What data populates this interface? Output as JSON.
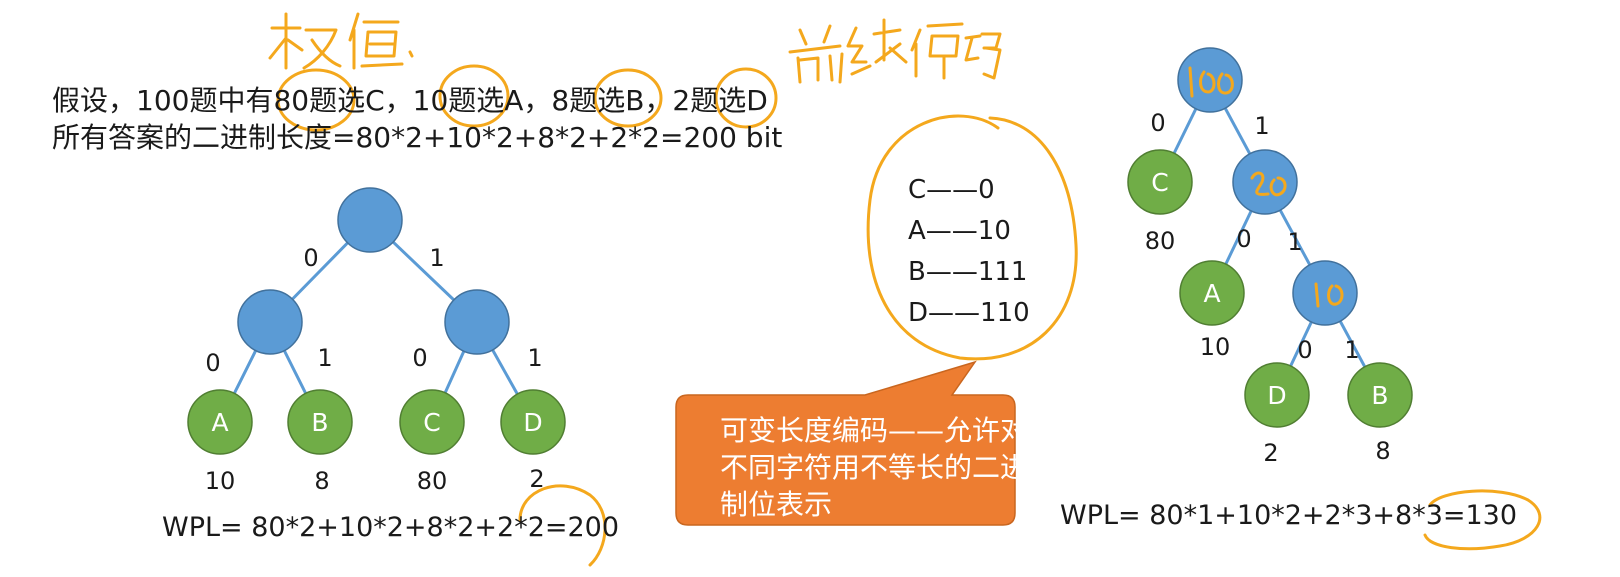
{
  "intro": {
    "line1": "假设，100题中有80题选C，10题选A，8题选B，2题选D",
    "line2": "所有答案的二进制长度=80*2+10*2+8*2+2*2=200 bit"
  },
  "handwriting": {
    "weight_note": "权值",
    "coding_note": "前缀编码"
  },
  "tree_fixed": {
    "edges": {
      "root_left": "0",
      "root_right": "1",
      "l_left": "0",
      "l_right": "1",
      "r_left": "0",
      "r_right": "1"
    },
    "leaves": [
      {
        "letter": "A",
        "weight": "10"
      },
      {
        "letter": "B",
        "weight": "8"
      },
      {
        "letter": "C",
        "weight": "80"
      },
      {
        "letter": "D",
        "weight": "2"
      }
    ],
    "wpl": "WPL= 80*2+10*2+8*2+2*2=200"
  },
  "codes": [
    "C——0",
    "A——10",
    "B——111",
    "D——110"
  ],
  "callout": {
    "text": "可变长度编码——允许对不同字符用不等长的二进制位表示",
    "color": "#ed7d31"
  },
  "tree_huffman": {
    "internal_notes": [
      "100",
      "20",
      "10"
    ],
    "edges": {
      "e1": "0",
      "e2": "1",
      "e3": "0",
      "e4": "1",
      "e5": "0",
      "e6": "1"
    },
    "leaves": [
      {
        "letter": "C",
        "weight": "80"
      },
      {
        "letter": "A",
        "weight": "10"
      },
      {
        "letter": "D",
        "weight": "2"
      },
      {
        "letter": "B",
        "weight": "8"
      }
    ],
    "wpl": "WPL= 80*1+10*2+2*3+8*3=130"
  },
  "colors": {
    "internal_node": "#5b9bd5",
    "leaf_node": "#70ad47",
    "annotation_ink": "#f4a81d"
  }
}
